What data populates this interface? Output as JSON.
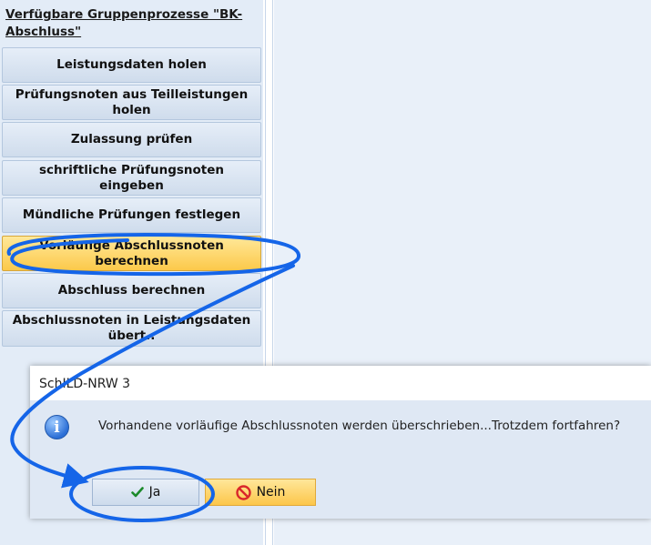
{
  "panel": {
    "title": "Verfügbare Gruppenprozesse \"BK-Abschluss\"",
    "buttons": [
      {
        "label": "Leistungsdaten holen",
        "active": false
      },
      {
        "label": "Prüfungsnoten aus Teilleistungen holen",
        "active": false
      },
      {
        "label": "Zulassung prüfen",
        "active": false
      },
      {
        "label": "schriftliche Prüfungsnoten eingeben",
        "active": false
      },
      {
        "label": "Mündliche Prüfungen festlegen",
        "active": false
      },
      {
        "label": "Vorläufige Abschlussnoten berechnen",
        "active": true
      },
      {
        "label": "Abschluss berechnen",
        "active": false
      },
      {
        "label": "Abschlussnoten in Leistungsdaten übert..",
        "active": false
      }
    ]
  },
  "dialog": {
    "title": "SchILD-NRW 3",
    "icon": "info-icon",
    "message": "Vorhandene vorläufige Abschlussnoten werden überschrieben...Trotzdem fortfahren?",
    "yes_label": "Ja",
    "no_label": "Nein"
  },
  "colors": {
    "active_button": "#fcc94a",
    "annotation": "#1565e8",
    "panel_bg": "#e3ecf7"
  }
}
